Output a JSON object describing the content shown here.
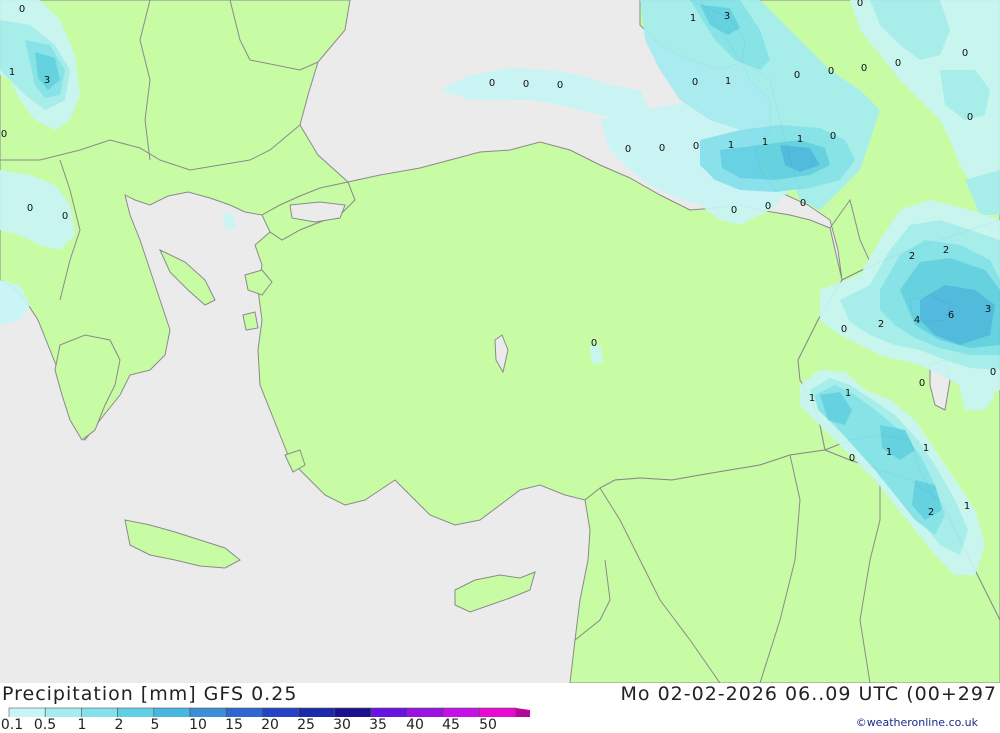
{
  "title": "Precipitation [mm] GFS 0.25",
  "run_info": "Mo 02-02-2026 06..09 UTC (00+297",
  "credit": "©weatheronline.co.uk",
  "legend": {
    "labels": [
      "0.1",
      "0.5",
      "1",
      "2",
      "5",
      "10",
      "15",
      "20",
      "25",
      "30",
      "35",
      "40",
      "45",
      "50"
    ],
    "colors": [
      "#c8f5f5",
      "#a5ecf0",
      "#82e1ec",
      "#5ecfe4",
      "#48b6e0",
      "#3c8ed8",
      "#2f67d2",
      "#2444c4",
      "#1a2aaa",
      "#1a128c",
      "#6a12e0",
      "#9a12e0",
      "#c612e6",
      "#e80ad2",
      "#b4089a"
    ]
  },
  "map_colors": {
    "sea": "#ebebeb",
    "land": "#c8fca4",
    "border": "#8a8a8a"
  },
  "contour_labels": [
    {
      "text": "0"
    },
    {
      "text": "1"
    },
    {
      "text": "3"
    },
    {
      "text": "0"
    },
    {
      "text": "0"
    },
    {
      "text": "0"
    },
    {
      "text": "1"
    },
    {
      "text": "3"
    },
    {
      "text": "0"
    },
    {
      "text": "0"
    },
    {
      "text": "0"
    },
    {
      "text": "0"
    },
    {
      "text": "1"
    },
    {
      "text": "0"
    },
    {
      "text": "0"
    },
    {
      "text": "0"
    },
    {
      "text": "0"
    },
    {
      "text": "0"
    },
    {
      "text": "0"
    },
    {
      "text": "0"
    },
    {
      "text": "0"
    },
    {
      "text": "0"
    },
    {
      "text": "1"
    },
    {
      "text": "1"
    },
    {
      "text": "1"
    },
    {
      "text": "0"
    },
    {
      "text": "0"
    },
    {
      "text": "0"
    },
    {
      "text": "0"
    },
    {
      "text": "2"
    },
    {
      "text": "2"
    },
    {
      "text": "4"
    },
    {
      "text": "6"
    },
    {
      "text": "3"
    },
    {
      "text": "0"
    },
    {
      "text": "2"
    },
    {
      "text": "0"
    },
    {
      "text": "0"
    },
    {
      "text": "1"
    },
    {
      "text": "1"
    },
    {
      "text": "0"
    },
    {
      "text": "1"
    },
    {
      "text": "1"
    },
    {
      "text": "2"
    },
    {
      "text": "1"
    },
    {
      "text": "0"
    },
    {
      "text": "0"
    }
  ]
}
